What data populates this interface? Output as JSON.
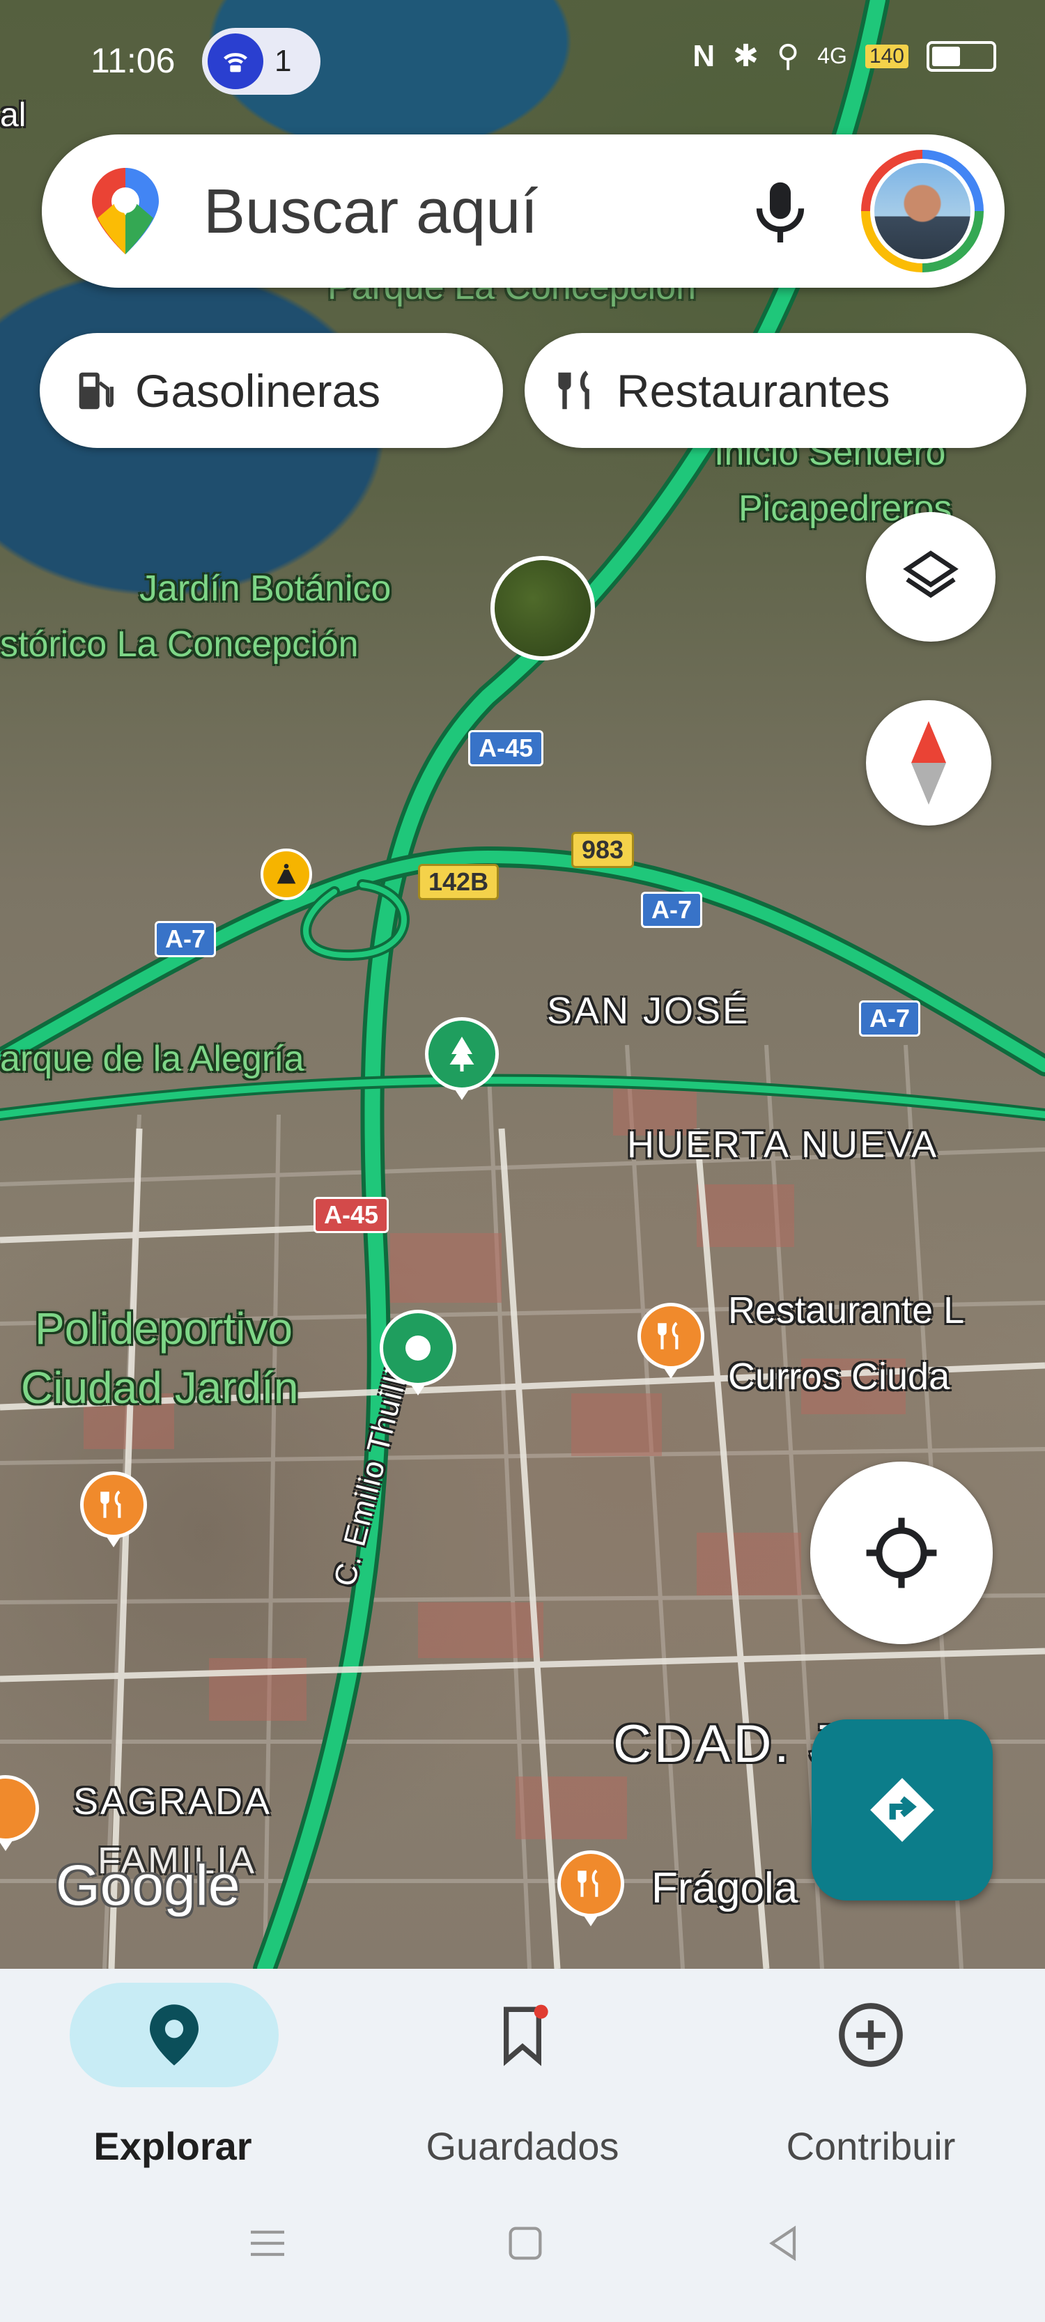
{
  "status_bar": {
    "time": "11:06",
    "hotspot_count": "1",
    "signal": "4G",
    "speed_badge": "140"
  },
  "search": {
    "placeholder": "Buscar aquí"
  },
  "chips": [
    {
      "label": "Gasolineras",
      "icon": "gas-station-icon"
    },
    {
      "label": "Restaurantes",
      "icon": "restaurant-icon"
    }
  ],
  "map": {
    "place_labels": [
      {
        "text": "Jardín Botánico"
      },
      {
        "text": "stórico La Concepción"
      },
      {
        "text": "Parque La Concepción"
      },
      {
        "text": "Inicio Sendero"
      },
      {
        "text": "Picapedreros"
      },
      {
        "text": "arque de la Alegría"
      },
      {
        "text": "Polideportivo"
      },
      {
        "text": "Ciudad Jardín"
      }
    ],
    "area_labels": [
      {
        "text": "SAN JOSÉ"
      },
      {
        "text": "HUERTA NUEVA"
      },
      {
        "text": "CDAD. JARD"
      },
      {
        "text": "SAGRADA"
      },
      {
        "text": "FAMILIA"
      }
    ],
    "street_label": "C. Emilio Thuillier",
    "poi_labels": [
      {
        "text": "Restaurante L"
      },
      {
        "text": "Curros Ciuda"
      },
      {
        "text": "Frágola"
      }
    ],
    "road_shields": [
      {
        "text": "A-45",
        "style": "blue"
      },
      {
        "text": "A-7",
        "style": "blue"
      },
      {
        "text": "A-7",
        "style": "blue"
      },
      {
        "text": "A-7",
        "style": "blue"
      },
      {
        "text": "142B",
        "style": "yellow"
      },
      {
        "text": "983",
        "style": "yellow"
      },
      {
        "text": "A-45",
        "style": "red"
      }
    ],
    "google_logo": "Google",
    "corner_label": "al"
  },
  "bottom_nav": [
    {
      "label": "Explorar",
      "icon": "location-pin-icon",
      "active": true
    },
    {
      "label": "Guardados",
      "icon": "bookmark-icon",
      "active": false
    },
    {
      "label": "Contribuir",
      "icon": "add-circle-icon",
      "active": false
    }
  ],
  "colors": {
    "accent": "#0c7d8a",
    "active_nav_bg": "#c8ecf5",
    "traffic_green": "#1fc77a"
  }
}
